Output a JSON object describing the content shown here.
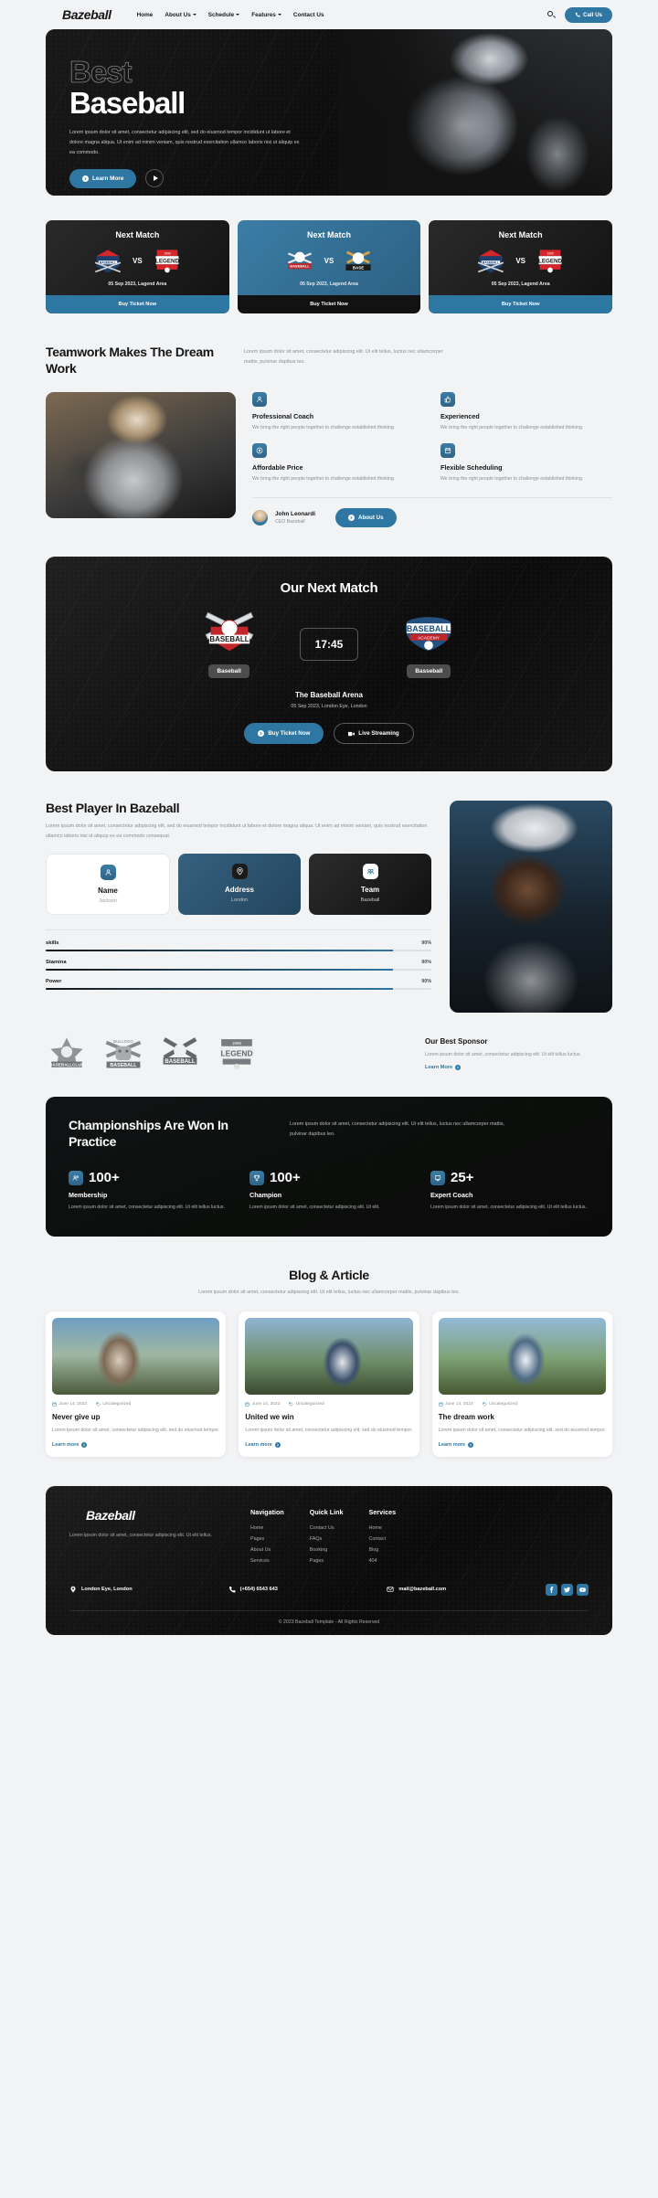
{
  "header": {
    "brand": "Bazeball",
    "nav": [
      {
        "label": "Home",
        "caret": false
      },
      {
        "label": "About Us",
        "caret": true
      },
      {
        "label": "Schedule",
        "caret": true
      },
      {
        "label": "Features",
        "caret": true
      },
      {
        "label": "Contact Us",
        "caret": false
      }
    ],
    "search_icon": "search-icon",
    "call_label": "Call Us"
  },
  "hero": {
    "title_outline": "Best",
    "title_solid": "Baseball",
    "paragraph": "Lorem ipsum dolor sit amet, consectetur adipiscing elit, sed do eiusmod tempor incididunt ut labore et dolore magna aliqua. Ut enim ad minim veniam, quis nostrud exercitation ullamco laboris nisi ut aliquip ex ea commodo.",
    "learn_more": "Learn More",
    "play_icon": "play-icon"
  },
  "matches": {
    "cards": [
      {
        "title": "Next Match",
        "vs": "VS",
        "date": "05 Sep 2023, Lagend Area",
        "cta": "Buy Ticket Now",
        "style": "dark",
        "left_logo": "baseball-championship-logo",
        "right_logo": "legend-baseball-logo"
      },
      {
        "title": "Next Match",
        "vs": "VS",
        "date": "05 Sep 2023, Lagend Area",
        "cta": "Buy Ticket Now",
        "style": "blue",
        "left_logo": "baseball-championship-logo",
        "right_logo": "baseball-club-logo"
      },
      {
        "title": "Next Match",
        "vs": "VS",
        "date": "05 Sep 2023, Lagend Area",
        "cta": "Buy Ticket Now",
        "style": "dark",
        "left_logo": "baseball-championship-logo",
        "right_logo": "legend-baseball-logo"
      }
    ]
  },
  "teamwork": {
    "heading": "Teamwork Makes The Dream Work",
    "paragraph": "Lorem ipsum dolor sit amet, consectetur adipiscing elit. Ut elit tellus, luctus nec ullamcorper mattis, pulvinar dapibus leo.",
    "features": [
      {
        "title": "Professional Coach",
        "desc": "We bring the right people together to challenge established thinking.",
        "icon": "coach-icon"
      },
      {
        "title": "Experienced",
        "desc": "We bring the right people together to challenge established thinking.",
        "icon": "thumbs-up-icon"
      },
      {
        "title": "Affordable Price",
        "desc": "We bring the right people together to challenge established thinking.",
        "icon": "price-tag-icon"
      },
      {
        "title": "Flexible Scheduling",
        "desc": "We bring the right people together to challenge established thinking.",
        "icon": "calendar-icon"
      }
    ],
    "author_name": "John Leonardi",
    "author_role": "CEO Bazeball",
    "about_label": "About Us"
  },
  "next_match": {
    "heading": "Our Next Match",
    "time": "17:45",
    "team_left": "Baseball",
    "team_right": "Basseball",
    "left_logo": "baseball-foundation-logo",
    "right_logo": "baseball-academy-logo",
    "arena": "The Baseball Arena",
    "location": "05 Sep 2023, London Eye, London",
    "ticket_label": "Buy Ticket Now",
    "stream_label": "Live Streaming"
  },
  "best_player": {
    "heading": "Best Player In Bazeball",
    "paragraph": "Lorem ipsum dolor sit amet, consectetur adipiscing elit, sed do eiusmod tempor incididunt ut labore et dolore magna aliqua. Ut enim ad minim veniam, quis nostrud exercitation ullamco laboris nisi ut aliquip ex ea commodo consequat.",
    "cards": [
      {
        "title": "Name",
        "value": "Jackson",
        "icon": "person-icon"
      },
      {
        "title": "Address",
        "value": "London",
        "icon": "location-pin-icon"
      },
      {
        "title": "Team",
        "value": "Bazeball",
        "icon": "team-icon"
      }
    ],
    "skills": [
      {
        "name": "skills",
        "percent": "90%",
        "value": 90
      },
      {
        "name": "Stamina",
        "percent": "90%",
        "value": 90
      },
      {
        "name": "Power",
        "percent": "90%",
        "value": 90
      }
    ]
  },
  "sponsors": {
    "logos": [
      "baseball-club-star-logo",
      "bulldog-baseball-logo",
      "baseball-crossed-bats-logo",
      "legend-1990-logo"
    ],
    "title": "Our Best Sponsor",
    "paragraph": "Lorem ipsum dolor sit amet, consectetur adipiscing elit. Ut elit tellus luctus.",
    "link": "Learn More"
  },
  "championships": {
    "heading": "Championships Are Won In Practice",
    "paragraph": "Lorem ipsum dolor sit amet, consectetur adipiscing elit. Ut elit tellus, luctus nec ullamcorper mattis, pulvinar dapibus leo.",
    "stats": [
      {
        "number": "100+",
        "label": "Membership",
        "desc": "Lorem ipsum dolor sit amet, consectetur adipiscing elit. Ut elit tellus luctus.",
        "icon": "members-icon"
      },
      {
        "number": "100+",
        "label": "Champion",
        "desc": "Lorem ipsum dolor sit amet, consectetur adipiscing elit. Ut elit.",
        "icon": "trophy-icon"
      },
      {
        "number": "25+",
        "label": "Expert Coach",
        "desc": "Lorem ipsum dolor sit amet, consectetur adipiscing elit. Ut elit tellus luctus.",
        "icon": "coach-badge-icon"
      }
    ]
  },
  "blog": {
    "heading": "Blog & Article",
    "paragraph": "Lorem ipsum dolor sit amet, consectetur adipiscing elit. Ut elit tellus, luctus nec ullamcorper mattis, pulvinar dapibus leo.",
    "posts": [
      {
        "date": "June 14, 2023",
        "category": "Uncategorized",
        "title": "Never give up",
        "excerpt": "Lorem ipsum dolor sit amet, consectetur adipiscing elit, sed do eiusmod tempor.",
        "more": "Learn more"
      },
      {
        "date": "June 14, 2023",
        "category": "Uncategorized",
        "title": "United we win",
        "excerpt": "Lorem ipsum dolor sit amet, consectetur adipiscing elit, sed do eiusmod tempor.",
        "more": "Learn more"
      },
      {
        "date": "June 14, 2023",
        "category": "Uncategorized",
        "title": "The dream work",
        "excerpt": "Lorem ipsum dolor sit amet, consectetur adipiscing elit, sed do eiusmod tempor.",
        "more": "Learn more"
      }
    ]
  },
  "footer": {
    "brand": "Bazeball",
    "about": "Lorem ipsum dolor sit amet, consectetur adipiscing elit. Ut elit tellus.",
    "columns": [
      {
        "title": "Navigation",
        "links": [
          "Home",
          "Pages",
          "About Us",
          "Services"
        ]
      },
      {
        "title": "Quick Link",
        "links": [
          "Contact Us",
          "FAQs",
          "Booking",
          "Pages"
        ]
      },
      {
        "title": "Services",
        "links": [
          "Home",
          "Contact",
          "Blog",
          "404"
        ]
      }
    ],
    "address": "London Eye, London",
    "phone": "(+654) 6543 643",
    "email": "mail@bazeball.com",
    "socials": [
      "facebook-icon",
      "twitter-icon",
      "youtube-icon"
    ],
    "copyright": "© 2023 Bazeball Template - All Rights Reserved"
  },
  "colors": {
    "accent": "#2f77a3",
    "dark": "#121212",
    "muted": "#8a8d91"
  }
}
